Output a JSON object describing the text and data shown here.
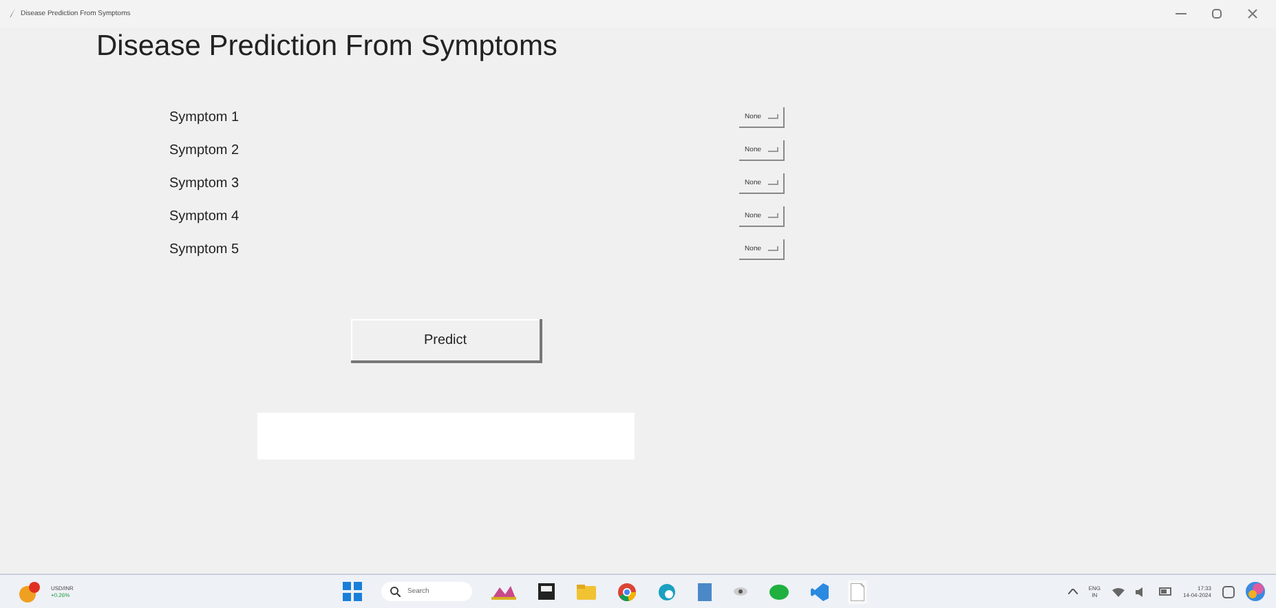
{
  "window": {
    "title": "Disease Prediction From Symptoms"
  },
  "heading": "Disease Prediction From Symptoms",
  "symptoms": [
    {
      "label": "Symptom 1",
      "value": "None"
    },
    {
      "label": "Symptom 2",
      "value": "None"
    },
    {
      "label": "Symptom 3",
      "value": "None"
    },
    {
      "label": "Symptom 4",
      "value": "None"
    },
    {
      "label": "Symptom 5",
      "value": "None"
    }
  ],
  "predict_button": "Predict",
  "taskbar": {
    "widget": {
      "title": "USD/INR",
      "change": "+0.26%"
    },
    "search_placeholder": "Search",
    "language": "ENG",
    "region": "IN",
    "time": "17:33",
    "date": "14-04-2024"
  }
}
